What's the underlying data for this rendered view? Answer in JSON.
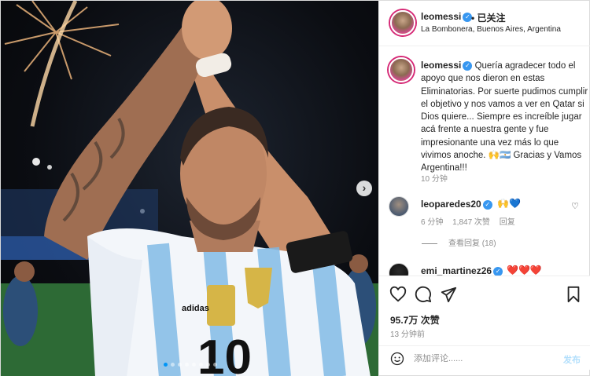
{
  "header": {
    "username": "leomessi",
    "follow_status": "• 已关注",
    "location": "La Bombonera, Buenos Aires, Argentina"
  },
  "caption": {
    "username": "leomessi",
    "text": "Quería agradecer todo el apoyo que nos dieron en estas Eliminatorias. Por suerte pudimos cumplir el objetivo y nos vamos a ver en Qatar si Dios quiere... Siempre es increíble jugar acá frente a nuestra gente y fue impresionante una vez más lo que vivimos anoche. 🙌🇦🇷 Gracias y Vamos Argentina!!!",
    "time": "10 分钟"
  },
  "comments": [
    {
      "username": "leoparedes20",
      "text": "🙌💙",
      "time": "6 分钟",
      "likes": "1,847 次赞",
      "reply_label": "回复",
      "view_replies": "查看回复 (18)"
    },
    {
      "username": "emi_martinez26",
      "text": "❤️❤️❤️"
    }
  ],
  "photo": {
    "icons": [
      "chevron-right-icon"
    ],
    "carousel_dots": 8,
    "active_dot": 0
  },
  "actions": {
    "icons": [
      "heart-icon",
      "comment-icon",
      "share-icon",
      "bookmark-icon"
    ],
    "likes": "95.7万 次赞",
    "time_ago": "13 分钟前"
  },
  "add_comment": {
    "placeholder": "添加评论......",
    "post_label": "发布"
  },
  "colors": {
    "verified": "#3897f0",
    "post_button": "#b2dffc",
    "story_ring": "#d62976",
    "border": "#dbdbdb"
  }
}
